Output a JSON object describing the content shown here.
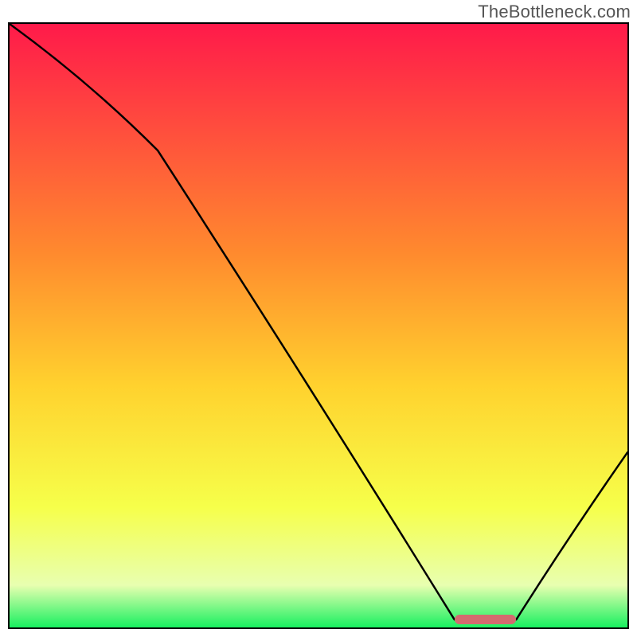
{
  "watermark": "TheBottleneck.com",
  "colors": {
    "gradient_top": "#ff1a4a",
    "gradient_upper_mid": "#ff6a2e",
    "gradient_mid": "#ffd22e",
    "gradient_lower_mid": "#f6ff4a",
    "gradient_low": "#e8ffb0",
    "gradient_bottom": "#18f060",
    "curve": "#000000",
    "marker": "#d46a6f",
    "frame": "#000000"
  },
  "chart_data": {
    "type": "line",
    "x": [
      0.0,
      0.24,
      0.72,
      0.75,
      0.82,
      1.0
    ],
    "values": [
      1.0,
      0.79,
      0.013,
      0.013,
      0.013,
      0.29
    ],
    "title": "",
    "xlabel": "",
    "ylabel": "",
    "xlim": [
      0,
      1
    ],
    "ylim": [
      0,
      1
    ],
    "valley_range_x": [
      0.72,
      0.82
    ],
    "gradient_stops": [
      {
        "offset": 0.0,
        "color": "#ff1a4a"
      },
      {
        "offset": 0.38,
        "color": "#ff8a2e"
      },
      {
        "offset": 0.6,
        "color": "#ffd22e"
      },
      {
        "offset": 0.8,
        "color": "#f6ff4a"
      },
      {
        "offset": 0.93,
        "color": "#e8ffb0"
      },
      {
        "offset": 1.0,
        "color": "#18f060"
      }
    ]
  }
}
